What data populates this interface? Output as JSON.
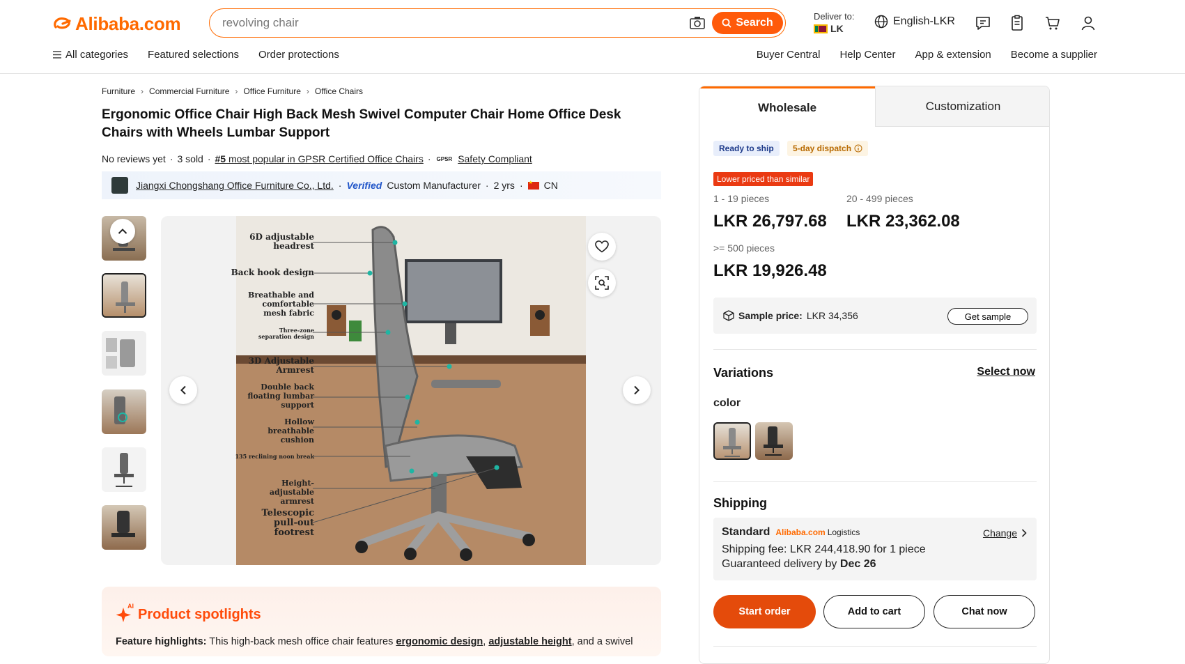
{
  "header": {
    "logo_text": "Alibaba.com",
    "search": {
      "value": "revolving chair",
      "button_label": "Search"
    },
    "deliver": {
      "label": "Deliver to:",
      "country": "LK"
    },
    "language": "English-LKR",
    "nav_left": [
      "All categories",
      "Featured selections",
      "Order protections"
    ],
    "nav_right": [
      "Buyer Central",
      "Help Center",
      "App & extension",
      "Become a supplier"
    ]
  },
  "breadcrumb": [
    "Furniture",
    "Commercial Furniture",
    "Office Furniture",
    "Office Chairs"
  ],
  "product": {
    "title": "Ergonomic Office Chair High Back Mesh Swivel Computer Chair Home Office Desk Chairs with Wheels Lumbar Support",
    "reviews": "No reviews yet",
    "sold": "3 sold",
    "rank_prefix": "#5",
    "rank_text": "most popular in GPSR Certified Office Chairs",
    "gpsr_label": "GPSR",
    "safety": "Safety Compliant"
  },
  "supplier": {
    "name": "Jiangxi Chongshang Office Furniture Co., Ltd.",
    "verified": "Verified",
    "type": "Custom Manufacturer",
    "years": "2 yrs",
    "country": "CN"
  },
  "gallery": {
    "callouts": [
      "6D adjustable headrest",
      "Back hook design",
      "Breathable and comfortable mesh fabric",
      "Three-zone separation design",
      "3D Adjustable Armrest",
      "Double back floating lumbar support",
      "Hollow breathable cushion",
      "135 reclining noon break",
      "Height-adjustable armrest",
      "Telescopic pull-out footrest"
    ]
  },
  "spotlight": {
    "title": "Product spotlights",
    "ai_badge": "AI",
    "highlight_label": "Feature highlights:",
    "text_1": "This high-back mesh office chair features",
    "bold_1": "ergonomic design",
    "bold_2": "adjustable height",
    "text_2": ", and a swivel"
  },
  "panel": {
    "tabs": [
      "Wholesale",
      "Customization"
    ],
    "chips": [
      "Ready to ship",
      "5-day dispatch"
    ],
    "lower_badge": "Lower priced than similar",
    "tiers": [
      {
        "qty": "1 - 19 pieces",
        "price": "LKR 26,797.68"
      },
      {
        "qty": "20 - 499 pieces",
        "price": "LKR 23,362.08"
      },
      {
        "qty": ">= 500 pieces",
        "price": "LKR 19,926.48"
      }
    ],
    "sample": {
      "label": "Sample price:",
      "price": "LKR 34,356",
      "button": "Get sample"
    },
    "variations": {
      "title": "Variations",
      "select": "Select now",
      "color_label": "color"
    },
    "shipping": {
      "title": "Shipping",
      "method": "Standard",
      "carrier": "Alibaba.com",
      "carrier_suffix": "Logistics",
      "change": "Change",
      "fee": "Shipping fee: LKR 244,418.90 for 1 piece",
      "delivery_prefix": "Guaranteed delivery by",
      "delivery_date": "Dec 26"
    },
    "actions": [
      "Start order",
      "Add to cart",
      "Chat now"
    ]
  },
  "colors": {
    "brand": "#ff6a00",
    "cta": "#e44b0b",
    "verified": "#2156c9"
  }
}
